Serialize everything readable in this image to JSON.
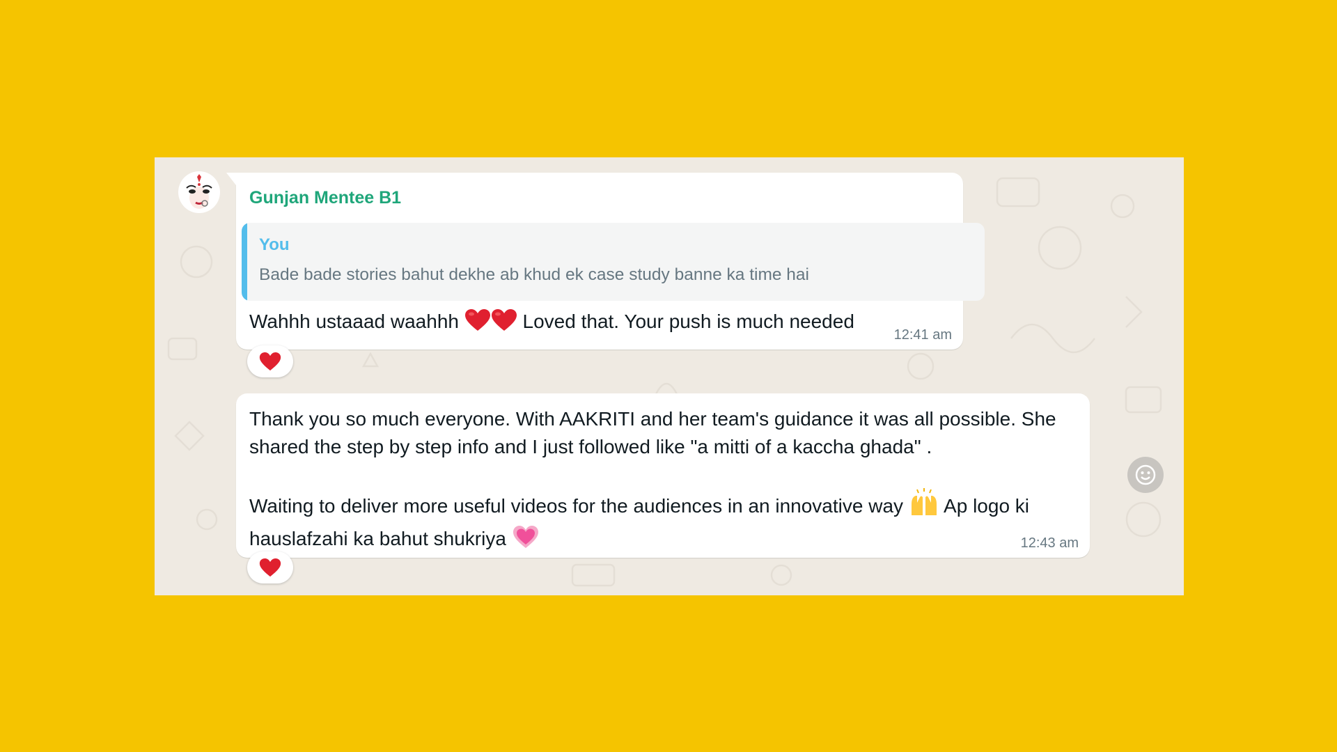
{
  "message1": {
    "sender": "Gunjan Mentee B1",
    "quote": {
      "author": "You",
      "text": "Bade bade stories bahut dekhe ab khud ek case study banne ka time hai"
    },
    "text_before": "Wahhh ustaaad waahhh",
    "emojis": [
      "red-heart-icon",
      "red-heart-icon"
    ],
    "text_after": "Loved that. Your push is much needed",
    "time": "12:41 am",
    "reaction": "red-heart-icon"
  },
  "message2": {
    "paragraph1": "Thank you so much everyone. With AAKRITI and her team's guidance it was all possible. She shared the step by step info and I just followed like \"a mitti of a kaccha ghada\" .",
    "paragraph2_part1": "Waiting to deliver more useful videos for the audiences in an innovative way",
    "emoji1": "raising-hands-icon",
    "paragraph2_part2": "Ap logo ki hauslafzahi ka bahut shukriya",
    "emoji2": "growing-heart-icon",
    "time": "12:43 am",
    "reaction": "red-heart-icon"
  },
  "colors": {
    "background": "#F5C400",
    "chat_wallpaper": "#EFEAE2",
    "sender_name": "#1FA67A",
    "quote_accent": "#53BDEB",
    "heart": "#E0202F"
  }
}
